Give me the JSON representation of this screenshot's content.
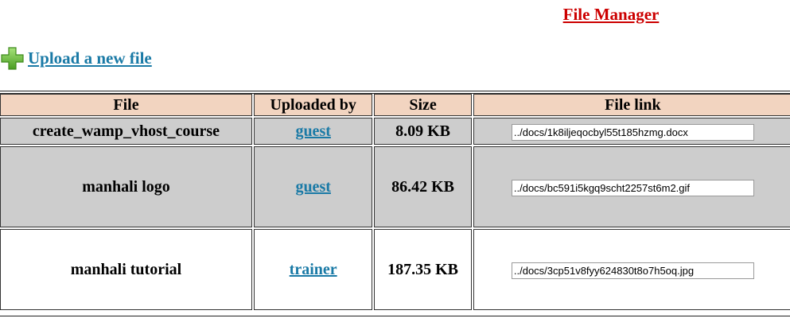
{
  "header": {
    "title": "File Manager"
  },
  "upload": {
    "label": "Upload a new file"
  },
  "table": {
    "columns": [
      "File",
      "Uploaded by",
      "Size",
      "File link"
    ],
    "rows": [
      {
        "file": "create_wamp_vhost_course",
        "uploaded_by": "guest",
        "size": "8.09 KB",
        "link": "../docs/1k8iljeqocbyl55t185hzmg.docx"
      },
      {
        "file": "manhali logo",
        "uploaded_by": "guest",
        "size": "86.42 KB",
        "link": "../docs/bc591i5kgq9scht2257st6m2.gif"
      },
      {
        "file": "manhali tutorial",
        "uploaded_by": "trainer",
        "size": "187.35 KB",
        "link": "../docs/3cp51v8fyy624830t8o7h5oq.jpg"
      }
    ]
  },
  "colors": {
    "title": "#cc0000",
    "link": "#1a7aa6",
    "header_bg": "#f2d4c0",
    "row_grey": "#cdcdcd",
    "plus_icon": "#6fc33a"
  }
}
